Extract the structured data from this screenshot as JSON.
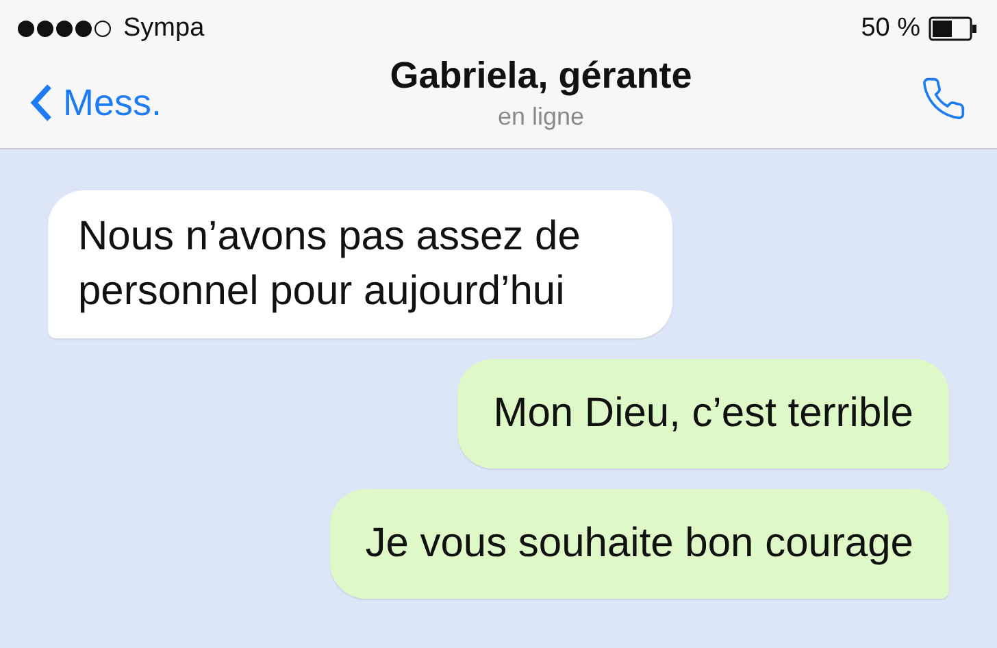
{
  "status_bar": {
    "carrier": "Sympa",
    "battery": "50 %"
  },
  "header": {
    "back_label": "Mess.",
    "title": "Gabriela, gérante",
    "subtitle": "en ligne"
  },
  "messages": [
    {
      "kind": "incoming",
      "text": "Nous n’avons pas assez de personnel pour aujourd’hui"
    },
    {
      "kind": "outgoing",
      "text": "Mon Dieu, c’est terrible"
    },
    {
      "kind": "outgoing",
      "text": "Je vous souhaite bon courage"
    }
  ]
}
